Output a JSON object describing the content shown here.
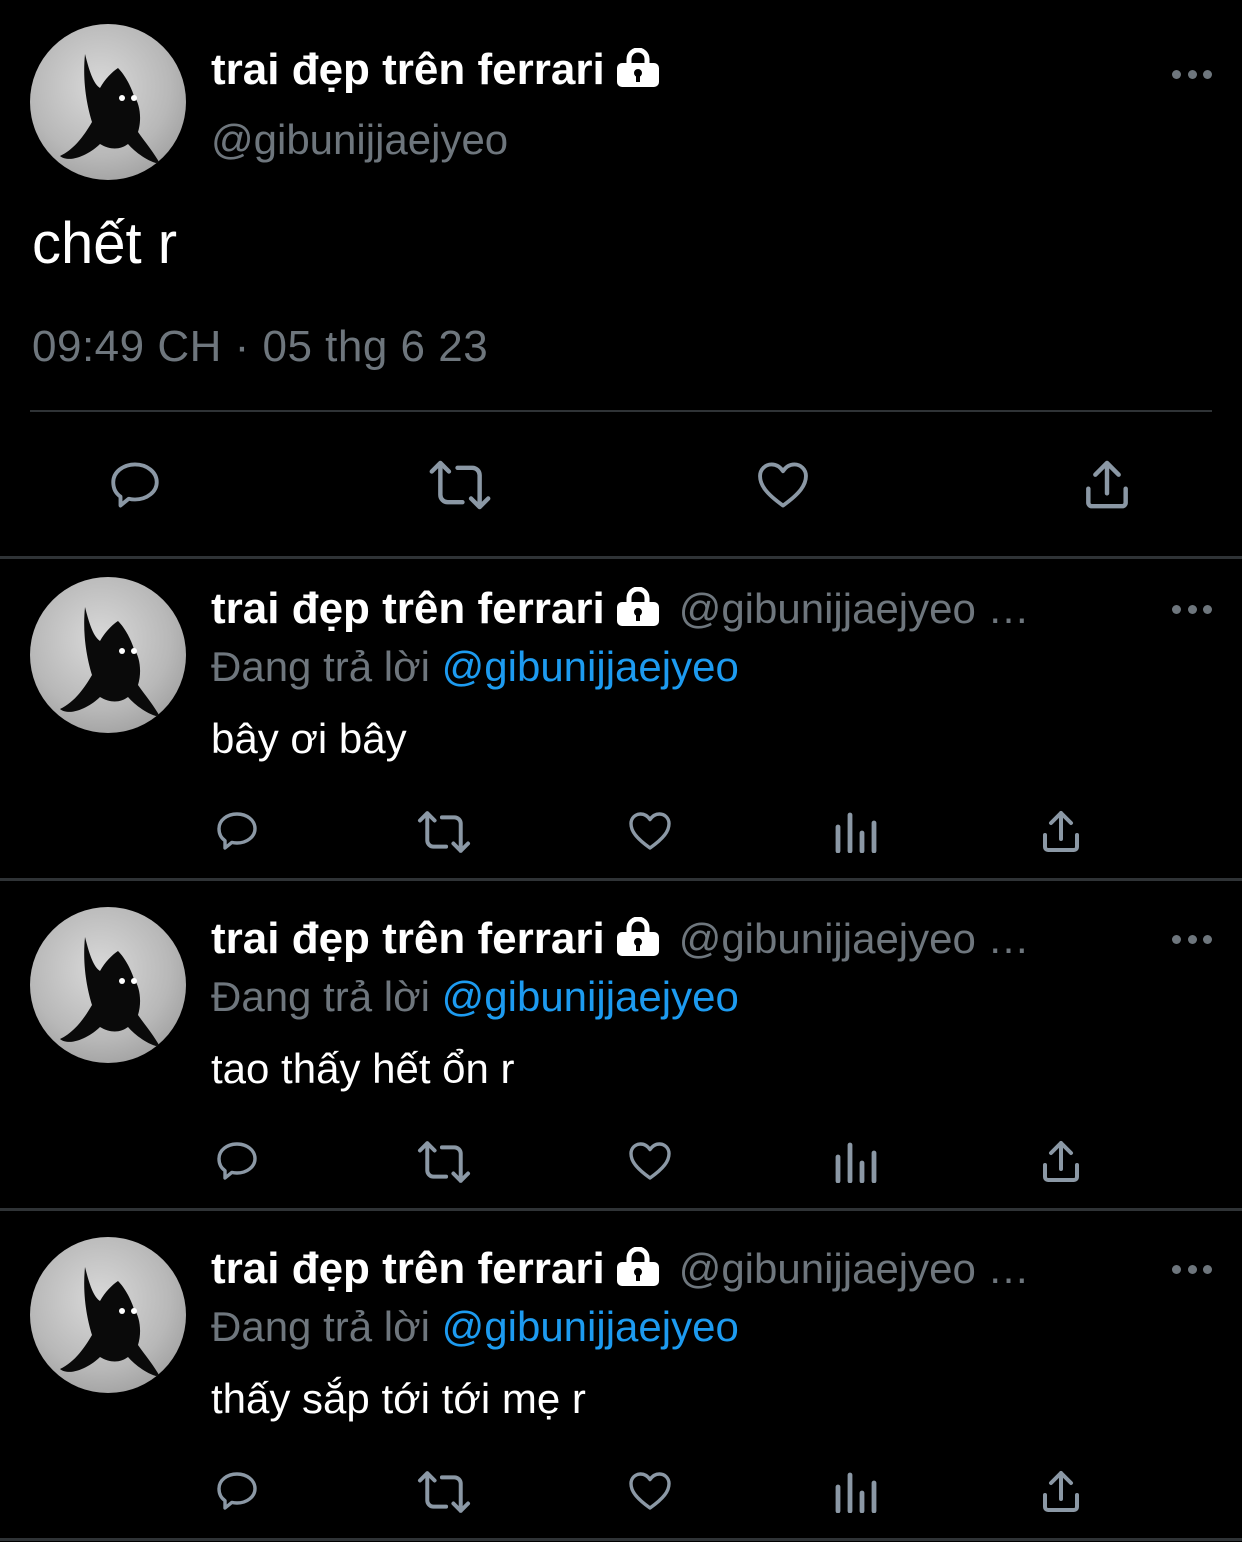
{
  "main_tweet": {
    "display_name": "trai đẹp trên ferrari",
    "handle": "@gibunijjaejyeo",
    "text": "chết r",
    "timestamp": "09:49 CH · 05 thg 6 23",
    "icons": [
      "lock-icon",
      "more-icon",
      "reply-icon",
      "retweet-icon",
      "like-icon",
      "share-icon"
    ]
  },
  "replies": [
    {
      "display_name": "trai đẹp trên ferrari",
      "handle": "@gibunijjaejyeo …",
      "replying_prefix": "Đang trả lời",
      "replying_to": "@gibunijjaejyeo",
      "text": "bây ơi bây"
    },
    {
      "display_name": "trai đẹp trên ferrari",
      "handle": "@gibunijjaejyeo …",
      "replying_prefix": "Đang trả lời",
      "replying_to": "@gibunijjaejyeo",
      "text": "tao thấy hết ổn r"
    },
    {
      "display_name": "trai đẹp trên ferrari",
      "handle": "@gibunijjaejyeo …",
      "replying_prefix": "Đang trả lời",
      "replying_to": "@gibunijjaejyeo",
      "text": "thấy sắp tới tới mẹ r"
    }
  ],
  "colors": {
    "background": "#000000",
    "primary_text": "#ffffff",
    "secondary_text": "#6e767d",
    "mention": "#1d9bf0",
    "icon": "#8b98a5",
    "divider": "#2f3336"
  }
}
